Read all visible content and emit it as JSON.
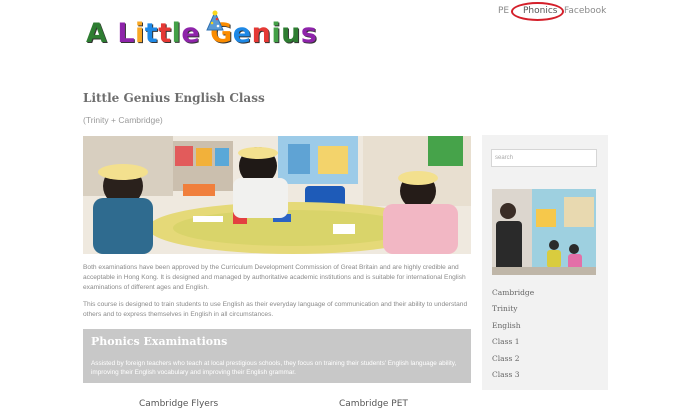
{
  "brand": {
    "logo_text": "A Little Genius",
    "logo_colors": [
      "#2e7d32",
      "#8e24aa",
      "#f9a825",
      "#1e88e5",
      "#e53935",
      "#43a047",
      "#8e24aa",
      "#fb8c00",
      "#1e88e5",
      "#e53935",
      "#43a047"
    ]
  },
  "nav": {
    "items": [
      {
        "label": "PE"
      },
      {
        "label": "Phonics"
      },
      {
        "label": "Facebook"
      }
    ],
    "highlight_color": "#d41f2a"
  },
  "main": {
    "title": "Little Genius English Class",
    "subtitle": "(Trinity + Cambridge)",
    "para1": "Both examinations have been approved by the Curriculum Development Commission of Great Britain and are highly credible and acceptable in Hong Kong. It is designed and managed by authoritative academic institutions and is suitable for international English examinations of different ages and English.",
    "para2": "This course is designed to train students to use English as their everyday language of communication and their ability to understand others and to express themselves in English in all circumstances.",
    "phonics": {
      "title": "Phonics Examinations",
      "text": "Assisted by foreign teachers who teach at local prestigious schools, they focus on training their students' English language ability, improving their English vocabulary and improving their English grammar."
    },
    "bottom_links": [
      "Cambridge Flyers",
      "Cambridge PET"
    ]
  },
  "sidebar": {
    "search_placeholder": "search",
    "links": [
      "Cambridge",
      "Trinity",
      "English",
      "Class 1",
      "Class 2",
      "Class 3"
    ]
  }
}
